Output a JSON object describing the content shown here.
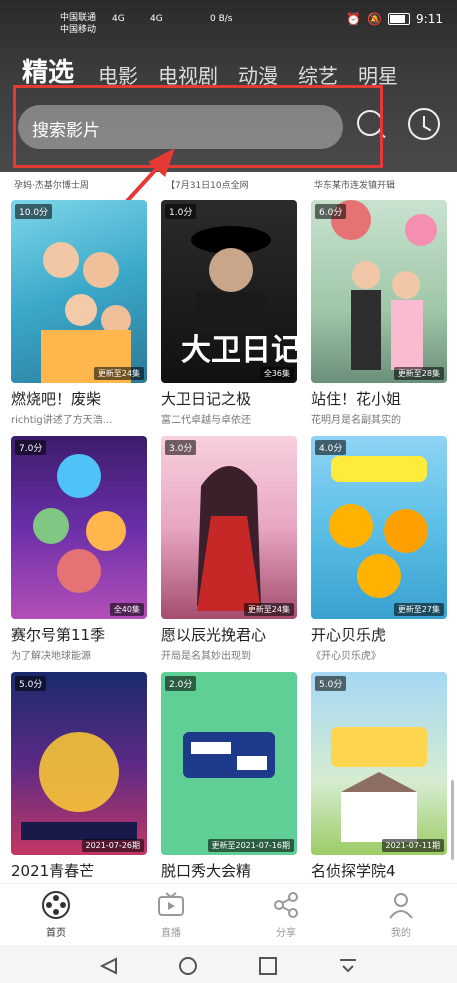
{
  "status": {
    "carrier1": "中国联通",
    "carrier2": "中国移动",
    "net1": "4G",
    "net2": "4G",
    "speed": "0 B/s",
    "time": "9:11"
  },
  "tabs": [
    "精选",
    "电影",
    "电视剧",
    "动漫",
    "综艺",
    "明星"
  ],
  "search": {
    "placeholder": "搜索影片"
  },
  "subtitles": [
    "孕妈·杰基尔博士周",
    "【7月31日10点全网",
    "华东某市连发镇开辑"
  ],
  "cards": [
    {
      "rating": "10.0分",
      "update": "更新至24集",
      "title": "燃烧吧！废柴",
      "desc": "richtig讲述了方天浩..."
    },
    {
      "rating": "1.0分",
      "update": "全36集",
      "title": "大卫日记之极",
      "desc": "富二代卓越与卓依还"
    },
    {
      "rating": "6.0分",
      "update": "更新至28集",
      "title": "站住！花小姐",
      "desc": "花明月是名副其实的"
    },
    {
      "rating": "7.0分",
      "update": "全40集",
      "title": "赛尔号第11季",
      "desc": "为了解决地球能源"
    },
    {
      "rating": "3.0分",
      "update": "更新至24集",
      "title": "愿以辰光挽君心",
      "desc": "开局是名其妙出现到"
    },
    {
      "rating": "4.0分",
      "update": "更新至27集",
      "title": "开心贝乐虎",
      "desc": "《开心贝乐虎》"
    },
    {
      "rating": "5.0分",
      "update": "2021-07-26期",
      "title": "2021青春芒",
      "desc": ""
    },
    {
      "rating": "2.0分",
      "update": "更新至2021-07-16期",
      "title": "脱口秀大会精",
      "desc": ""
    },
    {
      "rating": "5.0分",
      "update": "2021-07-11期",
      "title": "名侦探学院4",
      "desc": ""
    }
  ],
  "nav": [
    {
      "label": "首页",
      "icon": "home-film-reel-icon"
    },
    {
      "label": "直播",
      "icon": "tv-icon"
    },
    {
      "label": "分享",
      "icon": "share-icon"
    },
    {
      "label": "我的",
      "icon": "user-icon"
    }
  ],
  "colors": {
    "highlight": "#e53935",
    "header_bg": "#3b3b3b"
  }
}
